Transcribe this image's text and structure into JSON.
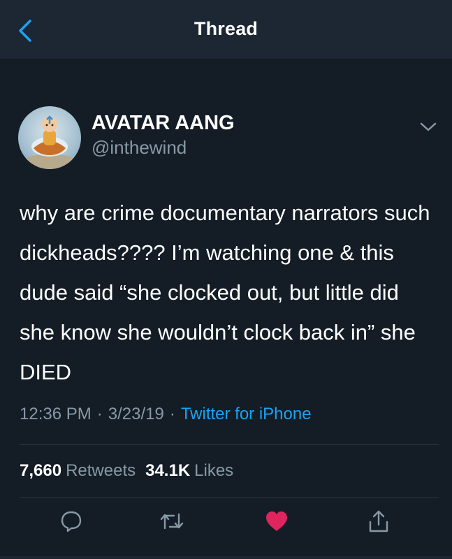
{
  "navbar": {
    "title": "Thread"
  },
  "tweet": {
    "display_name": "AVATAR AANG",
    "handle": "@inthewind",
    "text": "why are crime documentary narrators such dickheads???? I’m watching one & this dude said “she clocked out, but little did she know she wouldn’t clock back in” she DIED",
    "time": "12:36 PM",
    "date": "3/23/19",
    "source": "Twitter for iPhone",
    "separator": "·",
    "retweets_count": "7,660",
    "retweets_label": "Retweets",
    "likes_count": "34.1K",
    "likes_label": "Likes",
    "liked": true
  },
  "icons": {
    "back": "chevron-left-icon",
    "caret": "chevron-down-icon",
    "reply": "reply-icon",
    "retweet": "retweet-icon",
    "like": "heart-icon",
    "share": "share-icon"
  },
  "colors": {
    "background": "#141d26",
    "navbar": "#1c2733",
    "accent": "#1da1f2",
    "secondary_text": "#8899a6",
    "like": "#e0245e"
  }
}
